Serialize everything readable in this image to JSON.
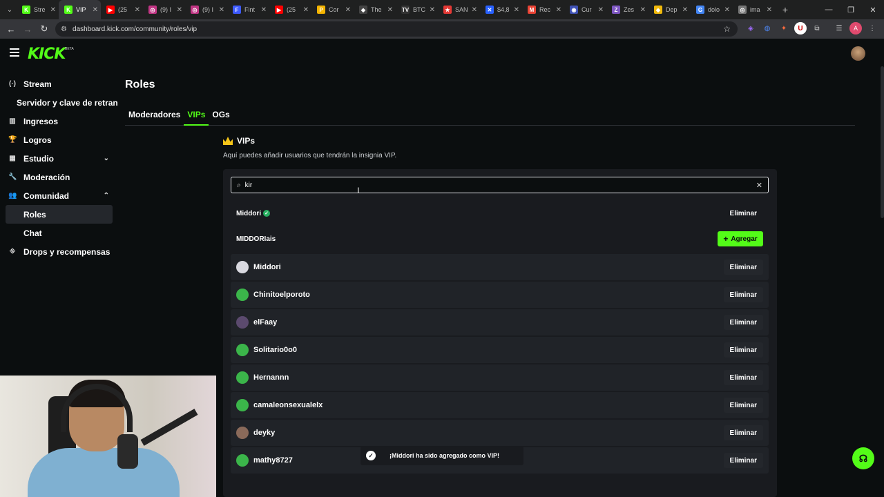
{
  "browser": {
    "tabs": [
      {
        "label": "Stre",
        "fav_color": "#53fc18",
        "fav_glyph": "K"
      },
      {
        "label": "VIP",
        "fav_color": "#53fc18",
        "fav_glyph": "K",
        "active": true
      },
      {
        "label": "(25",
        "fav_color": "#ff0000",
        "fav_glyph": "▶"
      },
      {
        "label": "(9) I",
        "fav_color": "#c13584",
        "fav_glyph": "◎"
      },
      {
        "label": "(9) I",
        "fav_color": "#c13584",
        "fav_glyph": "◎"
      },
      {
        "label": "Fint",
        "fav_color": "#3d5afe",
        "fav_glyph": "F"
      },
      {
        "label": "(25",
        "fav_color": "#ff0000",
        "fav_glyph": "▶"
      },
      {
        "label": "Cor",
        "fav_color": "#f4b400",
        "fav_glyph": "P"
      },
      {
        "label": "The",
        "fav_color": "#444444",
        "fav_glyph": "◆"
      },
      {
        "label": "BTC",
        "fav_color": "#333333",
        "fav_glyph": "TV"
      },
      {
        "label": "SAN",
        "fav_color": "#e53935",
        "fav_glyph": "★"
      },
      {
        "label": "$4,8",
        "fav_color": "#2962ff",
        "fav_glyph": "✕"
      },
      {
        "label": "Rec",
        "fav_color": "#ea4335",
        "fav_glyph": "M"
      },
      {
        "label": "Cur",
        "fav_color": "#3f51b5",
        "fav_glyph": "◉"
      },
      {
        "label": "Zes",
        "fav_color": "#7e57c2",
        "fav_glyph": "Z"
      },
      {
        "label": "Dep",
        "fav_color": "#f0b90b",
        "fav_glyph": "◆"
      },
      {
        "label": "dolo",
        "fav_color": "#4285f4",
        "fav_glyph": "G"
      },
      {
        "label": "ima",
        "fav_color": "#777777",
        "fav_glyph": "◎"
      }
    ],
    "url": "dashboard.kick.com/community/roles/vip",
    "profile_initial": "A",
    "ext_initial": "U"
  },
  "site": {
    "logo": "KICK",
    "beta": "BETA",
    "brand_color": "#53fc18"
  },
  "sidebar": {
    "items": [
      {
        "label": "Stream",
        "icon": "broadcast-icon",
        "glyph": "(·)"
      },
      {
        "label": "Servidor y clave de retransmisión",
        "sub": true
      },
      {
        "label": "Ingresos",
        "icon": "chart-icon",
        "glyph": "▥"
      },
      {
        "label": "Logros",
        "icon": "trophy-icon",
        "glyph": "🏆"
      },
      {
        "label": "Estudio",
        "icon": "studio-icon",
        "glyph": "▦",
        "chev": "⌄"
      },
      {
        "label": "Moderación",
        "icon": "wrench-icon",
        "glyph": "🔧"
      },
      {
        "label": "Comunidad",
        "icon": "people-icon",
        "glyph": "👥",
        "chev": "⌃"
      },
      {
        "label": "Roles",
        "subitem": true,
        "selected": true
      },
      {
        "label": "Chat",
        "subitem": true
      },
      {
        "label": "Drops y recompensas",
        "icon": "drops-icon",
        "glyph": "⛗"
      }
    ]
  },
  "main": {
    "title": "Roles",
    "tabs": [
      {
        "label": "Moderadores"
      },
      {
        "label": "VIPs",
        "active": true
      },
      {
        "label": "OGs"
      }
    ],
    "section_title": "VIPs",
    "section_desc": "Aquí puedes añadir usuarios que tendrán la insignia VIP.",
    "search": {
      "value": "kir",
      "clear_glyph": "✕"
    },
    "results": [
      {
        "name": "Middori",
        "verified": true,
        "action": "Eliminar"
      },
      {
        "name": "MIDDORIais",
        "verified": false,
        "action": "Agregar"
      }
    ],
    "vips": [
      {
        "name": "Middori",
        "avatar_color": "#d9d9e0"
      },
      {
        "name": "Chinitoelporoto",
        "avatar_color": "#3bb54a"
      },
      {
        "name": "elFaay",
        "avatar_color": "#5b4a6e"
      },
      {
        "name": "Solitario0o0",
        "avatar_color": "#3bb54a"
      },
      {
        "name": "Hernannn",
        "avatar_color": "#3bb54a"
      },
      {
        "name": "camaleonsexualelx",
        "avatar_color": "#3bb54a"
      },
      {
        "name": "deyky",
        "avatar_color": "#8a6a5a"
      },
      {
        "name": "mathy8727",
        "avatar_color": "#3bb54a"
      }
    ],
    "remove_label": "Eliminar",
    "add_label": "Agregar",
    "toast": "¡Middori ha sido agregado como VIP!"
  }
}
